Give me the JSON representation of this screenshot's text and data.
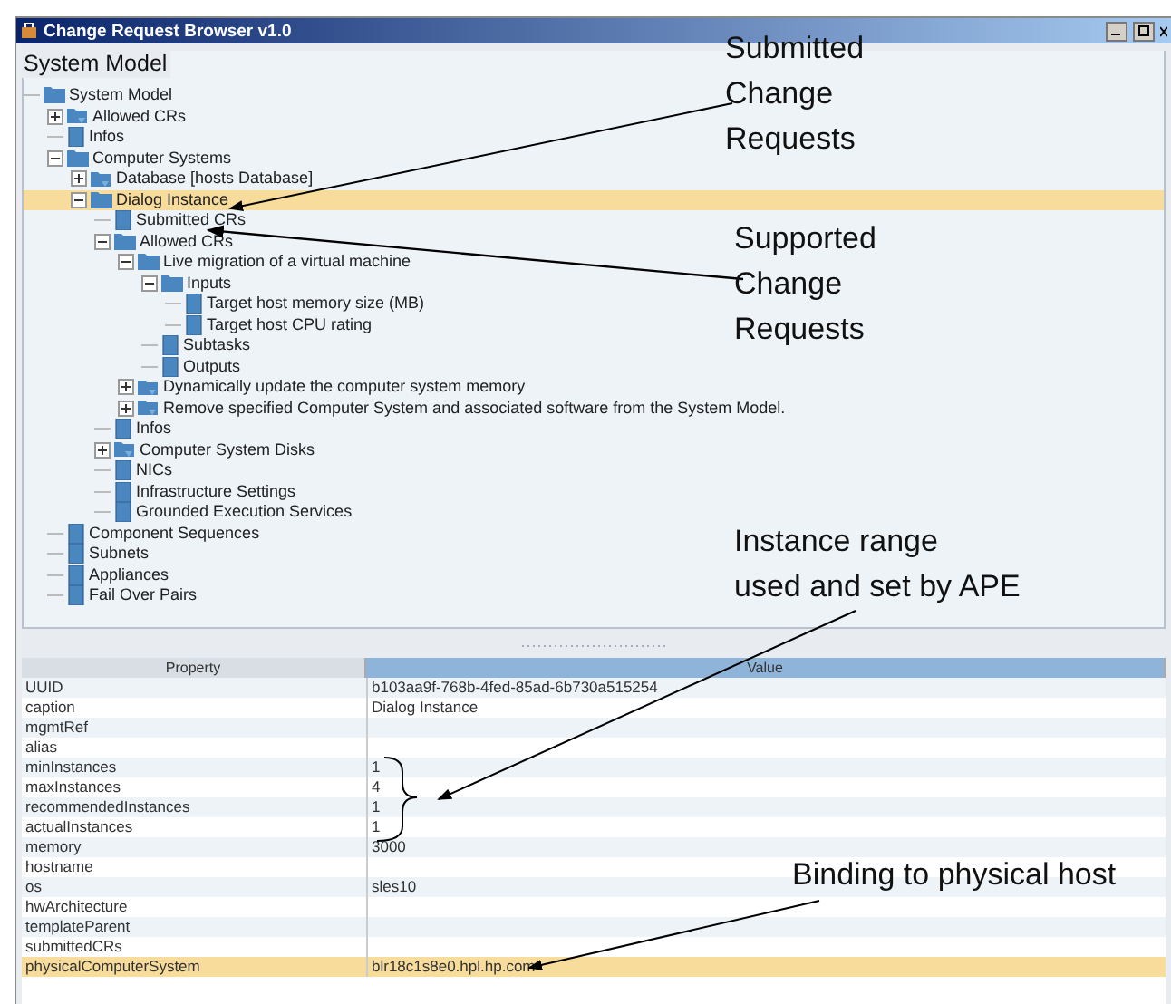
{
  "window": {
    "title": "Change Request Browser v1.0"
  },
  "tree_panel": {
    "title": "System Model"
  },
  "tree": [
    {
      "label": "System Model",
      "kind": "folder",
      "selected": false,
      "children": [
        {
          "label": "Allowed CRs",
          "kind": "action",
          "expanded": false,
          "selected": false
        },
        {
          "label": "Infos",
          "kind": "page",
          "selected": false
        },
        {
          "label": "Computer Systems",
          "kind": "folder",
          "expanded": true,
          "selected": false,
          "children": [
            {
              "label": "Database [hosts Database]",
              "kind": "action",
              "expanded": false,
              "selected": false
            },
            {
              "label": "Dialog Instance",
              "kind": "folder",
              "expanded": true,
              "selected": true,
              "children": [
                {
                  "label": "Submitted CRs",
                  "kind": "page",
                  "selected": false
                },
                {
                  "label": "Allowed CRs",
                  "kind": "folder",
                  "expanded": true,
                  "selected": false,
                  "children": [
                    {
                      "label": "Live migration of a virtual machine",
                      "kind": "folder",
                      "expanded": true,
                      "selected": false,
                      "children": [
                        {
                          "label": "Inputs",
                          "kind": "folder",
                          "expanded": true,
                          "selected": false,
                          "children": [
                            {
                              "label": "Target host memory size (MB)",
                              "kind": "page",
                              "selected": false
                            },
                            {
                              "label": "Target host CPU rating",
                              "kind": "page",
                              "selected": false
                            }
                          ]
                        },
                        {
                          "label": "Subtasks",
                          "kind": "page",
                          "selected": false
                        },
                        {
                          "label": "Outputs",
                          "kind": "page",
                          "selected": false
                        }
                      ]
                    },
                    {
                      "label": "Dynamically update the computer system memory",
                      "kind": "action",
                      "expanded": false,
                      "selected": false
                    },
                    {
                      "label": "Remove specified Computer System and associated software from the System Model.",
                      "kind": "action",
                      "expanded": false,
                      "selected": false
                    }
                  ]
                },
                {
                  "label": "Infos",
                  "kind": "page",
                  "selected": false
                },
                {
                  "label": "Computer System Disks",
                  "kind": "action",
                  "expanded": false,
                  "selected": false
                },
                {
                  "label": "NICs",
                  "kind": "page",
                  "selected": false
                },
                {
                  "label": "Infrastructure Settings",
                  "kind": "page",
                  "selected": false
                },
                {
                  "label": "Grounded Execution Services",
                  "kind": "page",
                  "selected": false
                }
              ]
            }
          ]
        },
        {
          "label": "Component Sequences",
          "kind": "page",
          "selected": false
        },
        {
          "label": "Subnets",
          "kind": "page",
          "selected": false
        },
        {
          "label": "Appliances",
          "kind": "page",
          "selected": false
        },
        {
          "label": "Fail Over Pairs",
          "kind": "page",
          "selected": false
        }
      ]
    }
  ],
  "table": {
    "columns": [
      "Property",
      "Value"
    ],
    "rows": [
      {
        "property": "UUID",
        "value": "b103aa9f-768b-4fed-85ad-6b730a515254",
        "selected": false
      },
      {
        "property": "caption",
        "value": "Dialog Instance",
        "selected": false
      },
      {
        "property": "mgmtRef",
        "value": "",
        "selected": false
      },
      {
        "property": "alias",
        "value": "",
        "selected": false
      },
      {
        "property": "minInstances",
        "value": "1",
        "selected": false
      },
      {
        "property": "maxInstances",
        "value": "4",
        "selected": false
      },
      {
        "property": "recommendedInstances",
        "value": "1",
        "selected": false
      },
      {
        "property": "actualInstances",
        "value": "1",
        "selected": false
      },
      {
        "property": "memory",
        "value": "3000",
        "selected": false
      },
      {
        "property": "hostname",
        "value": "",
        "selected": false
      },
      {
        "property": "os",
        "value": "sles10",
        "selected": false
      },
      {
        "property": "hwArchitecture",
        "value": "",
        "selected": false
      },
      {
        "property": "templateParent",
        "value": "",
        "selected": false
      },
      {
        "property": "submittedCRs",
        "value": "",
        "selected": false
      },
      {
        "property": "physicalComputerSystem",
        "value": "blr18c1s8e0.hpl.hp.com",
        "selected": true
      }
    ]
  },
  "annotations": [
    {
      "lines": [
        "Submitted",
        "Change",
        "Requests"
      ]
    },
    {
      "lines": [
        "Supported",
        "Change",
        "Requests"
      ]
    },
    {
      "lines": [
        "Instance range",
        "used and set by APE"
      ]
    },
    {
      "lines": [
        "Binding to physical host"
      ]
    }
  ]
}
